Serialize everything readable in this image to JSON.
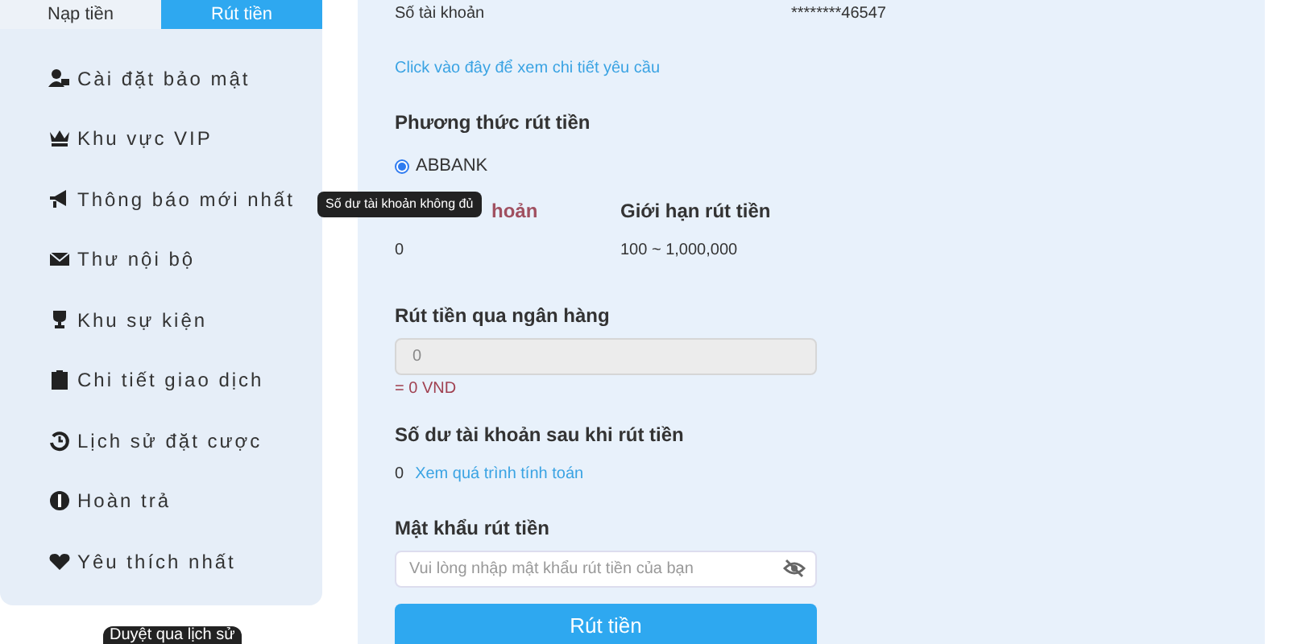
{
  "tabs": [
    {
      "label": "Nạp tiền",
      "selected": false
    },
    {
      "label": "Rút tiền",
      "selected": true
    }
  ],
  "sidebar": {
    "items": [
      {
        "label": "Cài đặt bảo mật"
      },
      {
        "label": "Khu vực VIP"
      },
      {
        "label": "Thông báo mới nhất"
      },
      {
        "label": "Thư nội bộ"
      },
      {
        "label": "Khu sự kiện"
      },
      {
        "label": "Chi tiết giao dịch"
      },
      {
        "label": "Lịch sử đặt cược"
      },
      {
        "label": "Hoàn trả"
      },
      {
        "label": "Yêu thích nhất"
      }
    ]
  },
  "bottom_tooltip": "Duyệt qua lịch sử",
  "account": {
    "label": "Số tài khoản",
    "value": "********46547"
  },
  "details_link": "Click vào đây để xem chi tiết yêu cầu",
  "method": {
    "title": "Phương thức rút tiền",
    "options": [
      {
        "label": "ABBANK",
        "selected": true
      }
    ]
  },
  "balance": {
    "label": "hoản",
    "value": "0",
    "tooltip": "Số dư tài khoản không đủ"
  },
  "limit": {
    "label": "Giới hạn rút tiền",
    "value": "100 ~ 1,000,000"
  },
  "amount": {
    "label": "Rút tiền qua ngân hàng",
    "value": "0",
    "converted": "= 0 VND"
  },
  "after": {
    "label": "Số dư tài khoản sau khi rút tiền",
    "value": "0",
    "link": "Xem quá trình tính toán"
  },
  "password": {
    "label": "Mật khẩu rút tiền",
    "placeholder": "Vui lòng nhập mật khẩu rút tiền của bạn"
  },
  "submit": "Rút tiền"
}
